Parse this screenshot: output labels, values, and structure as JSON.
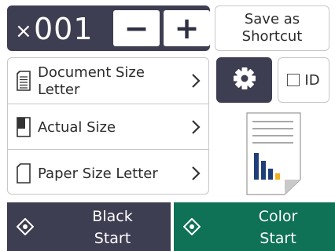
{
  "copies": {
    "prefix": "×",
    "count": "001",
    "minus_label": "−",
    "plus_label": "+"
  },
  "shortcut": {
    "line1": "Save as",
    "line2": "Shortcut"
  },
  "settings": [
    {
      "line1": "Document Size",
      "line2": "Letter",
      "icon": "document-size-icon"
    },
    {
      "line1": "Actual Size",
      "line2": "",
      "icon": "actual-size-icon"
    },
    {
      "line1": "Paper Size Letter",
      "line2": "",
      "icon": "paper-size-icon"
    }
  ],
  "id_option": {
    "label": "ID",
    "checked": false
  },
  "start": {
    "black_line1": "Black",
    "black_line2": "Start",
    "color_line1": "Color",
    "color_line2": "Start"
  },
  "colors": {
    "dark": "#3e3e52",
    "green": "#0f7155",
    "border": "#c7c7c7"
  }
}
